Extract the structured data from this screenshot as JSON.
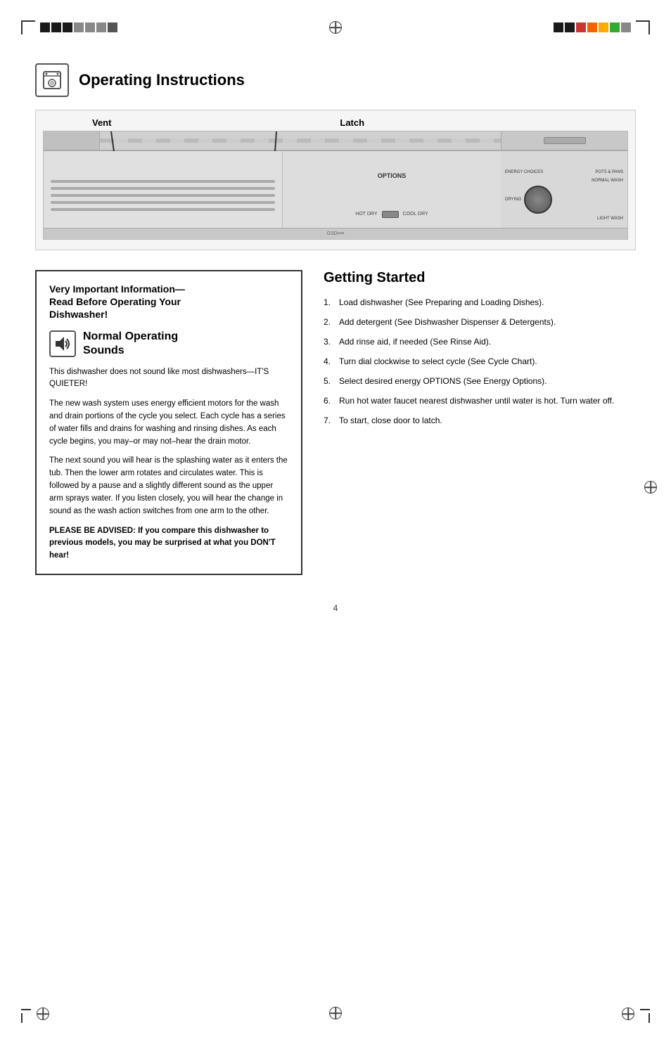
{
  "page": {
    "number": "4",
    "title": "Operating Instructions"
  },
  "header": {
    "section_title": "Operating Instructions",
    "vent_label": "Vent",
    "latch_label": "Latch"
  },
  "diagram": {
    "options_label": "OPTIONS",
    "hot_dry_label": "HOT DRY",
    "cool_dry_label": "COOL DRY",
    "pots_pans_label": "POTS & PANS",
    "normal_wash_label": "NORMAL WASH",
    "light_wash_label": "LIGHT WASH",
    "drying_label": "DRYING",
    "energy_choices_label": "ENERGY CHOICES"
  },
  "important_info": {
    "title": "Very Important Information—\nRead Before Operating Your\nDishwasher!",
    "nos_title_line1": "Normal Operating",
    "nos_title_line2": "Sounds",
    "para1": "This dishwasher does not sound like most dishwashers—IT'S QUIETER!",
    "para2": "The new wash system uses energy efficient motors for the wash and drain portions of the cycle you select. Each cycle has a series of water fills and drains for washing and rinsing dishes. As each cycle begins, you may–or may not–hear the drain motor.",
    "para3": "The next sound you will hear is the splashing water as it enters the tub. Then the lower arm rotates and circulates water. This is followed by a pause and a slightly different sound as the upper arm sprays water. If you listen closely, you will hear the change in sound as the wash action switches from one arm to the other.",
    "bold_para": "PLEASE BE ADVISED: If you compare this dishwasher to previous models, you may be surprised at what you DON'T hear!"
  },
  "getting_started": {
    "title": "Getting Started",
    "steps": [
      {
        "number": "1.",
        "text": "Load dishwasher (See Preparing and Loading Dishes)."
      },
      {
        "number": "2.",
        "text": "Add detergent (See Dishwasher Dispenser & Detergents)."
      },
      {
        "number": "3.",
        "text": "Add rinse aid, if needed (See Rinse Aid)."
      },
      {
        "number": "4.",
        "text": "Turn dial clockwise to select cycle (See Cycle Chart)."
      },
      {
        "number": "5.",
        "text": "Select desired energy OPTIONS (See Energy Options)."
      },
      {
        "number": "6.",
        "text": "Run hot water faucet nearest dishwasher until water is hot. Turn water off."
      },
      {
        "number": "7.",
        "text": "To start, close door to latch."
      }
    ]
  }
}
